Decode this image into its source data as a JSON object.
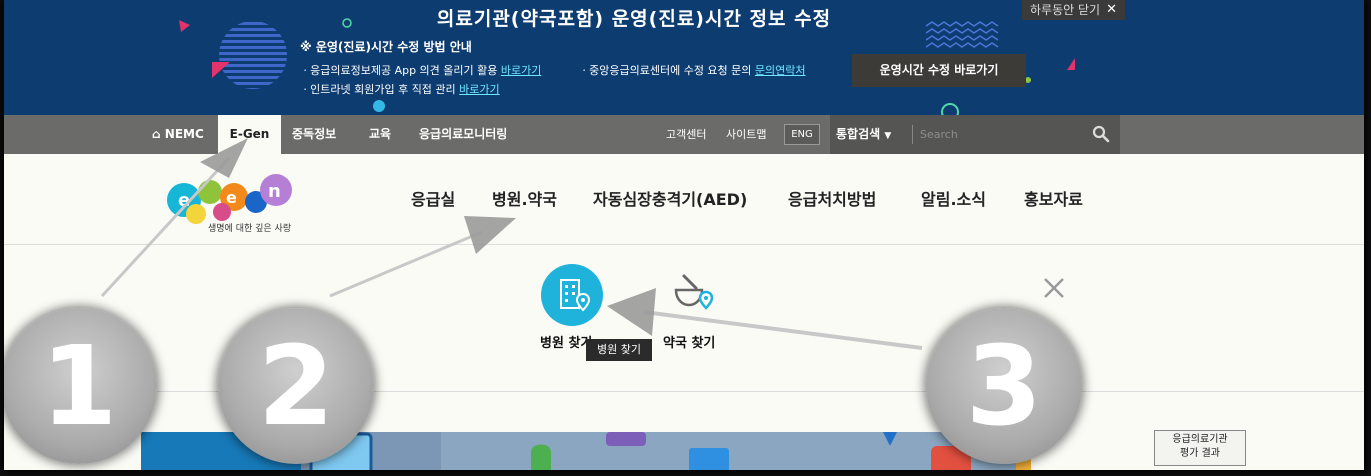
{
  "banner": {
    "title": "의료기관(약국포함) 운영(진료)시간 정보 수정",
    "close_label": "하루동안 닫기",
    "heading": "※ 운영(진료)시간 수정 방법 안내",
    "lines": [
      {
        "text": "ㆍ응급의료정보제공 App 의견 올리기 활용",
        "link": "바로가기"
      },
      {
        "text": "ㆍ중앙응급의료센터에 수정 요청 문의",
        "link": "문의연락처"
      },
      {
        "text": "ㆍ인트라넷 회원가입 후 직접 관리",
        "link": "바로가기"
      }
    ],
    "button": "운영시간 수정 바로가기"
  },
  "topnav": {
    "items": [
      "NEMC",
      "E-Gen",
      "중독정보",
      "교육",
      "응급의료모니터링"
    ],
    "utility": [
      "고객센터",
      "사이트맵",
      "ENG"
    ],
    "search_scope": "통합검색",
    "search_placeholder": "Search"
  },
  "logo": {
    "tagline": "생명에 대한 깊은 사랑"
  },
  "mainnav": [
    "응급실",
    "병원.약국",
    "자동심장충격기(AED)",
    "응급처치방법",
    "알림.소식",
    "홍보자료"
  ],
  "panel": {
    "hospital_label": "병원 찾기",
    "pharmacy_label": "약국 찾기",
    "tooltip": "병원 찾기"
  },
  "bottom": {
    "eval_line1": "응급의료기관",
    "eval_line2": "평가 결과"
  },
  "annotations": [
    "1",
    "2",
    "3"
  ],
  "colors": {
    "banner": "#0d3c70",
    "nav": "#6b6b69",
    "accent": "#1fb3dc",
    "link": "#6fe7ff"
  }
}
